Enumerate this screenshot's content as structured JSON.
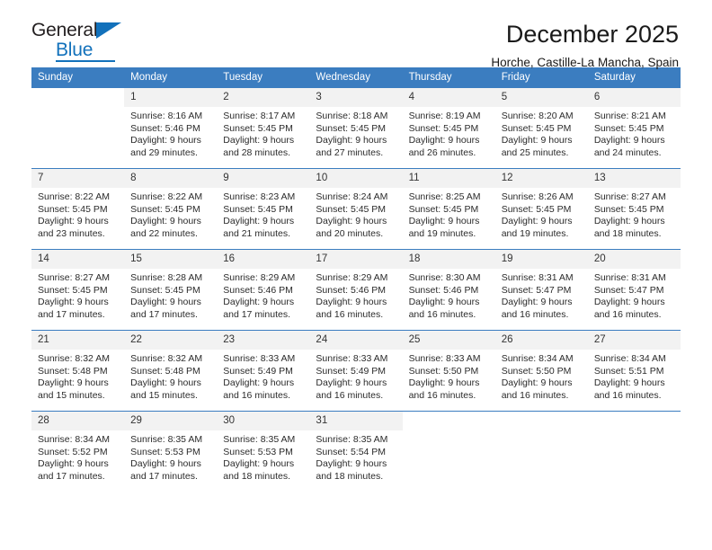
{
  "brand": {
    "name_part1": "General",
    "name_part2": "Blue",
    "accent_color": "#1271bb"
  },
  "header": {
    "month_title": "December 2025",
    "location": "Horche, Castille-La Mancha, Spain"
  },
  "calendar": {
    "header_color": "#3b7dc0",
    "weekdays": [
      "Sunday",
      "Monday",
      "Tuesday",
      "Wednesday",
      "Thursday",
      "Friday",
      "Saturday"
    ],
    "weeks": [
      [
        {
          "blank": true
        },
        {
          "day": "1",
          "sunrise": "Sunrise: 8:16 AM",
          "sunset": "Sunset: 5:46 PM",
          "daylight_line1": "Daylight: 9 hours",
          "daylight_line2": "and 29 minutes."
        },
        {
          "day": "2",
          "sunrise": "Sunrise: 8:17 AM",
          "sunset": "Sunset: 5:45 PM",
          "daylight_line1": "Daylight: 9 hours",
          "daylight_line2": "and 28 minutes."
        },
        {
          "day": "3",
          "sunrise": "Sunrise: 8:18 AM",
          "sunset": "Sunset: 5:45 PM",
          "daylight_line1": "Daylight: 9 hours",
          "daylight_line2": "and 27 minutes."
        },
        {
          "day": "4",
          "sunrise": "Sunrise: 8:19 AM",
          "sunset": "Sunset: 5:45 PM",
          "daylight_line1": "Daylight: 9 hours",
          "daylight_line2": "and 26 minutes."
        },
        {
          "day": "5",
          "sunrise": "Sunrise: 8:20 AM",
          "sunset": "Sunset: 5:45 PM",
          "daylight_line1": "Daylight: 9 hours",
          "daylight_line2": "and 25 minutes."
        },
        {
          "day": "6",
          "sunrise": "Sunrise: 8:21 AM",
          "sunset": "Sunset: 5:45 PM",
          "daylight_line1": "Daylight: 9 hours",
          "daylight_line2": "and 24 minutes."
        }
      ],
      [
        {
          "day": "7",
          "sunrise": "Sunrise: 8:22 AM",
          "sunset": "Sunset: 5:45 PM",
          "daylight_line1": "Daylight: 9 hours",
          "daylight_line2": "and 23 minutes."
        },
        {
          "day": "8",
          "sunrise": "Sunrise: 8:22 AM",
          "sunset": "Sunset: 5:45 PM",
          "daylight_line1": "Daylight: 9 hours",
          "daylight_line2": "and 22 minutes."
        },
        {
          "day": "9",
          "sunrise": "Sunrise: 8:23 AM",
          "sunset": "Sunset: 5:45 PM",
          "daylight_line1": "Daylight: 9 hours",
          "daylight_line2": "and 21 minutes."
        },
        {
          "day": "10",
          "sunrise": "Sunrise: 8:24 AM",
          "sunset": "Sunset: 5:45 PM",
          "daylight_line1": "Daylight: 9 hours",
          "daylight_line2": "and 20 minutes."
        },
        {
          "day": "11",
          "sunrise": "Sunrise: 8:25 AM",
          "sunset": "Sunset: 5:45 PM",
          "daylight_line1": "Daylight: 9 hours",
          "daylight_line2": "and 19 minutes."
        },
        {
          "day": "12",
          "sunrise": "Sunrise: 8:26 AM",
          "sunset": "Sunset: 5:45 PM",
          "daylight_line1": "Daylight: 9 hours",
          "daylight_line2": "and 19 minutes."
        },
        {
          "day": "13",
          "sunrise": "Sunrise: 8:27 AM",
          "sunset": "Sunset: 5:45 PM",
          "daylight_line1": "Daylight: 9 hours",
          "daylight_line2": "and 18 minutes."
        }
      ],
      [
        {
          "day": "14",
          "sunrise": "Sunrise: 8:27 AM",
          "sunset": "Sunset: 5:45 PM",
          "daylight_line1": "Daylight: 9 hours",
          "daylight_line2": "and 17 minutes."
        },
        {
          "day": "15",
          "sunrise": "Sunrise: 8:28 AM",
          "sunset": "Sunset: 5:45 PM",
          "daylight_line1": "Daylight: 9 hours",
          "daylight_line2": "and 17 minutes."
        },
        {
          "day": "16",
          "sunrise": "Sunrise: 8:29 AM",
          "sunset": "Sunset: 5:46 PM",
          "daylight_line1": "Daylight: 9 hours",
          "daylight_line2": "and 17 minutes."
        },
        {
          "day": "17",
          "sunrise": "Sunrise: 8:29 AM",
          "sunset": "Sunset: 5:46 PM",
          "daylight_line1": "Daylight: 9 hours",
          "daylight_line2": "and 16 minutes."
        },
        {
          "day": "18",
          "sunrise": "Sunrise: 8:30 AM",
          "sunset": "Sunset: 5:46 PM",
          "daylight_line1": "Daylight: 9 hours",
          "daylight_line2": "and 16 minutes."
        },
        {
          "day": "19",
          "sunrise": "Sunrise: 8:31 AM",
          "sunset": "Sunset: 5:47 PM",
          "daylight_line1": "Daylight: 9 hours",
          "daylight_line2": "and 16 minutes."
        },
        {
          "day": "20",
          "sunrise": "Sunrise: 8:31 AM",
          "sunset": "Sunset: 5:47 PM",
          "daylight_line1": "Daylight: 9 hours",
          "daylight_line2": "and 16 minutes."
        }
      ],
      [
        {
          "day": "21",
          "sunrise": "Sunrise: 8:32 AM",
          "sunset": "Sunset: 5:48 PM",
          "daylight_line1": "Daylight: 9 hours",
          "daylight_line2": "and 15 minutes."
        },
        {
          "day": "22",
          "sunrise": "Sunrise: 8:32 AM",
          "sunset": "Sunset: 5:48 PM",
          "daylight_line1": "Daylight: 9 hours",
          "daylight_line2": "and 15 minutes."
        },
        {
          "day": "23",
          "sunrise": "Sunrise: 8:33 AM",
          "sunset": "Sunset: 5:49 PM",
          "daylight_line1": "Daylight: 9 hours",
          "daylight_line2": "and 16 minutes."
        },
        {
          "day": "24",
          "sunrise": "Sunrise: 8:33 AM",
          "sunset": "Sunset: 5:49 PM",
          "daylight_line1": "Daylight: 9 hours",
          "daylight_line2": "and 16 minutes."
        },
        {
          "day": "25",
          "sunrise": "Sunrise: 8:33 AM",
          "sunset": "Sunset: 5:50 PM",
          "daylight_line1": "Daylight: 9 hours",
          "daylight_line2": "and 16 minutes."
        },
        {
          "day": "26",
          "sunrise": "Sunrise: 8:34 AM",
          "sunset": "Sunset: 5:50 PM",
          "daylight_line1": "Daylight: 9 hours",
          "daylight_line2": "and 16 minutes."
        },
        {
          "day": "27",
          "sunrise": "Sunrise: 8:34 AM",
          "sunset": "Sunset: 5:51 PM",
          "daylight_line1": "Daylight: 9 hours",
          "daylight_line2": "and 16 minutes."
        }
      ],
      [
        {
          "day": "28",
          "sunrise": "Sunrise: 8:34 AM",
          "sunset": "Sunset: 5:52 PM",
          "daylight_line1": "Daylight: 9 hours",
          "daylight_line2": "and 17 minutes."
        },
        {
          "day": "29",
          "sunrise": "Sunrise: 8:35 AM",
          "sunset": "Sunset: 5:53 PM",
          "daylight_line1": "Daylight: 9 hours",
          "daylight_line2": "and 17 minutes."
        },
        {
          "day": "30",
          "sunrise": "Sunrise: 8:35 AM",
          "sunset": "Sunset: 5:53 PM",
          "daylight_line1": "Daylight: 9 hours",
          "daylight_line2": "and 18 minutes."
        },
        {
          "day": "31",
          "sunrise": "Sunrise: 8:35 AM",
          "sunset": "Sunset: 5:54 PM",
          "daylight_line1": "Daylight: 9 hours",
          "daylight_line2": "and 18 minutes."
        },
        {
          "blank": true
        },
        {
          "blank": true
        },
        {
          "blank": true
        }
      ]
    ]
  }
}
